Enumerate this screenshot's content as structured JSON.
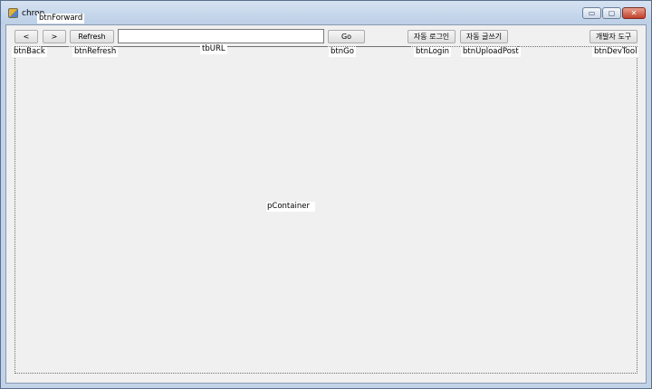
{
  "window": {
    "title": "chron",
    "controls": {
      "minimize": "▭",
      "maximize": "▢",
      "close": "✕"
    }
  },
  "toolbar": {
    "back_label": "<",
    "forward_label": ">",
    "refresh_label": "Refresh",
    "url_value": "",
    "go_label": "Go",
    "login_label": "자동 로그인",
    "upload_label": "자동 글쓰기",
    "devtool_label": "개발자 도구"
  },
  "design_labels": {
    "btnForward": "btnForward",
    "btnBack": "btnBack",
    "btnRefresh": "btnRefresh",
    "tbURL": "tbURL",
    "btnGo": "btnGo",
    "btnLogin": "btnLogin",
    "btnUploadPost": "btnUploadPost",
    "btnDevTool": "btnDevTool",
    "pContainer": "pContainer"
  }
}
